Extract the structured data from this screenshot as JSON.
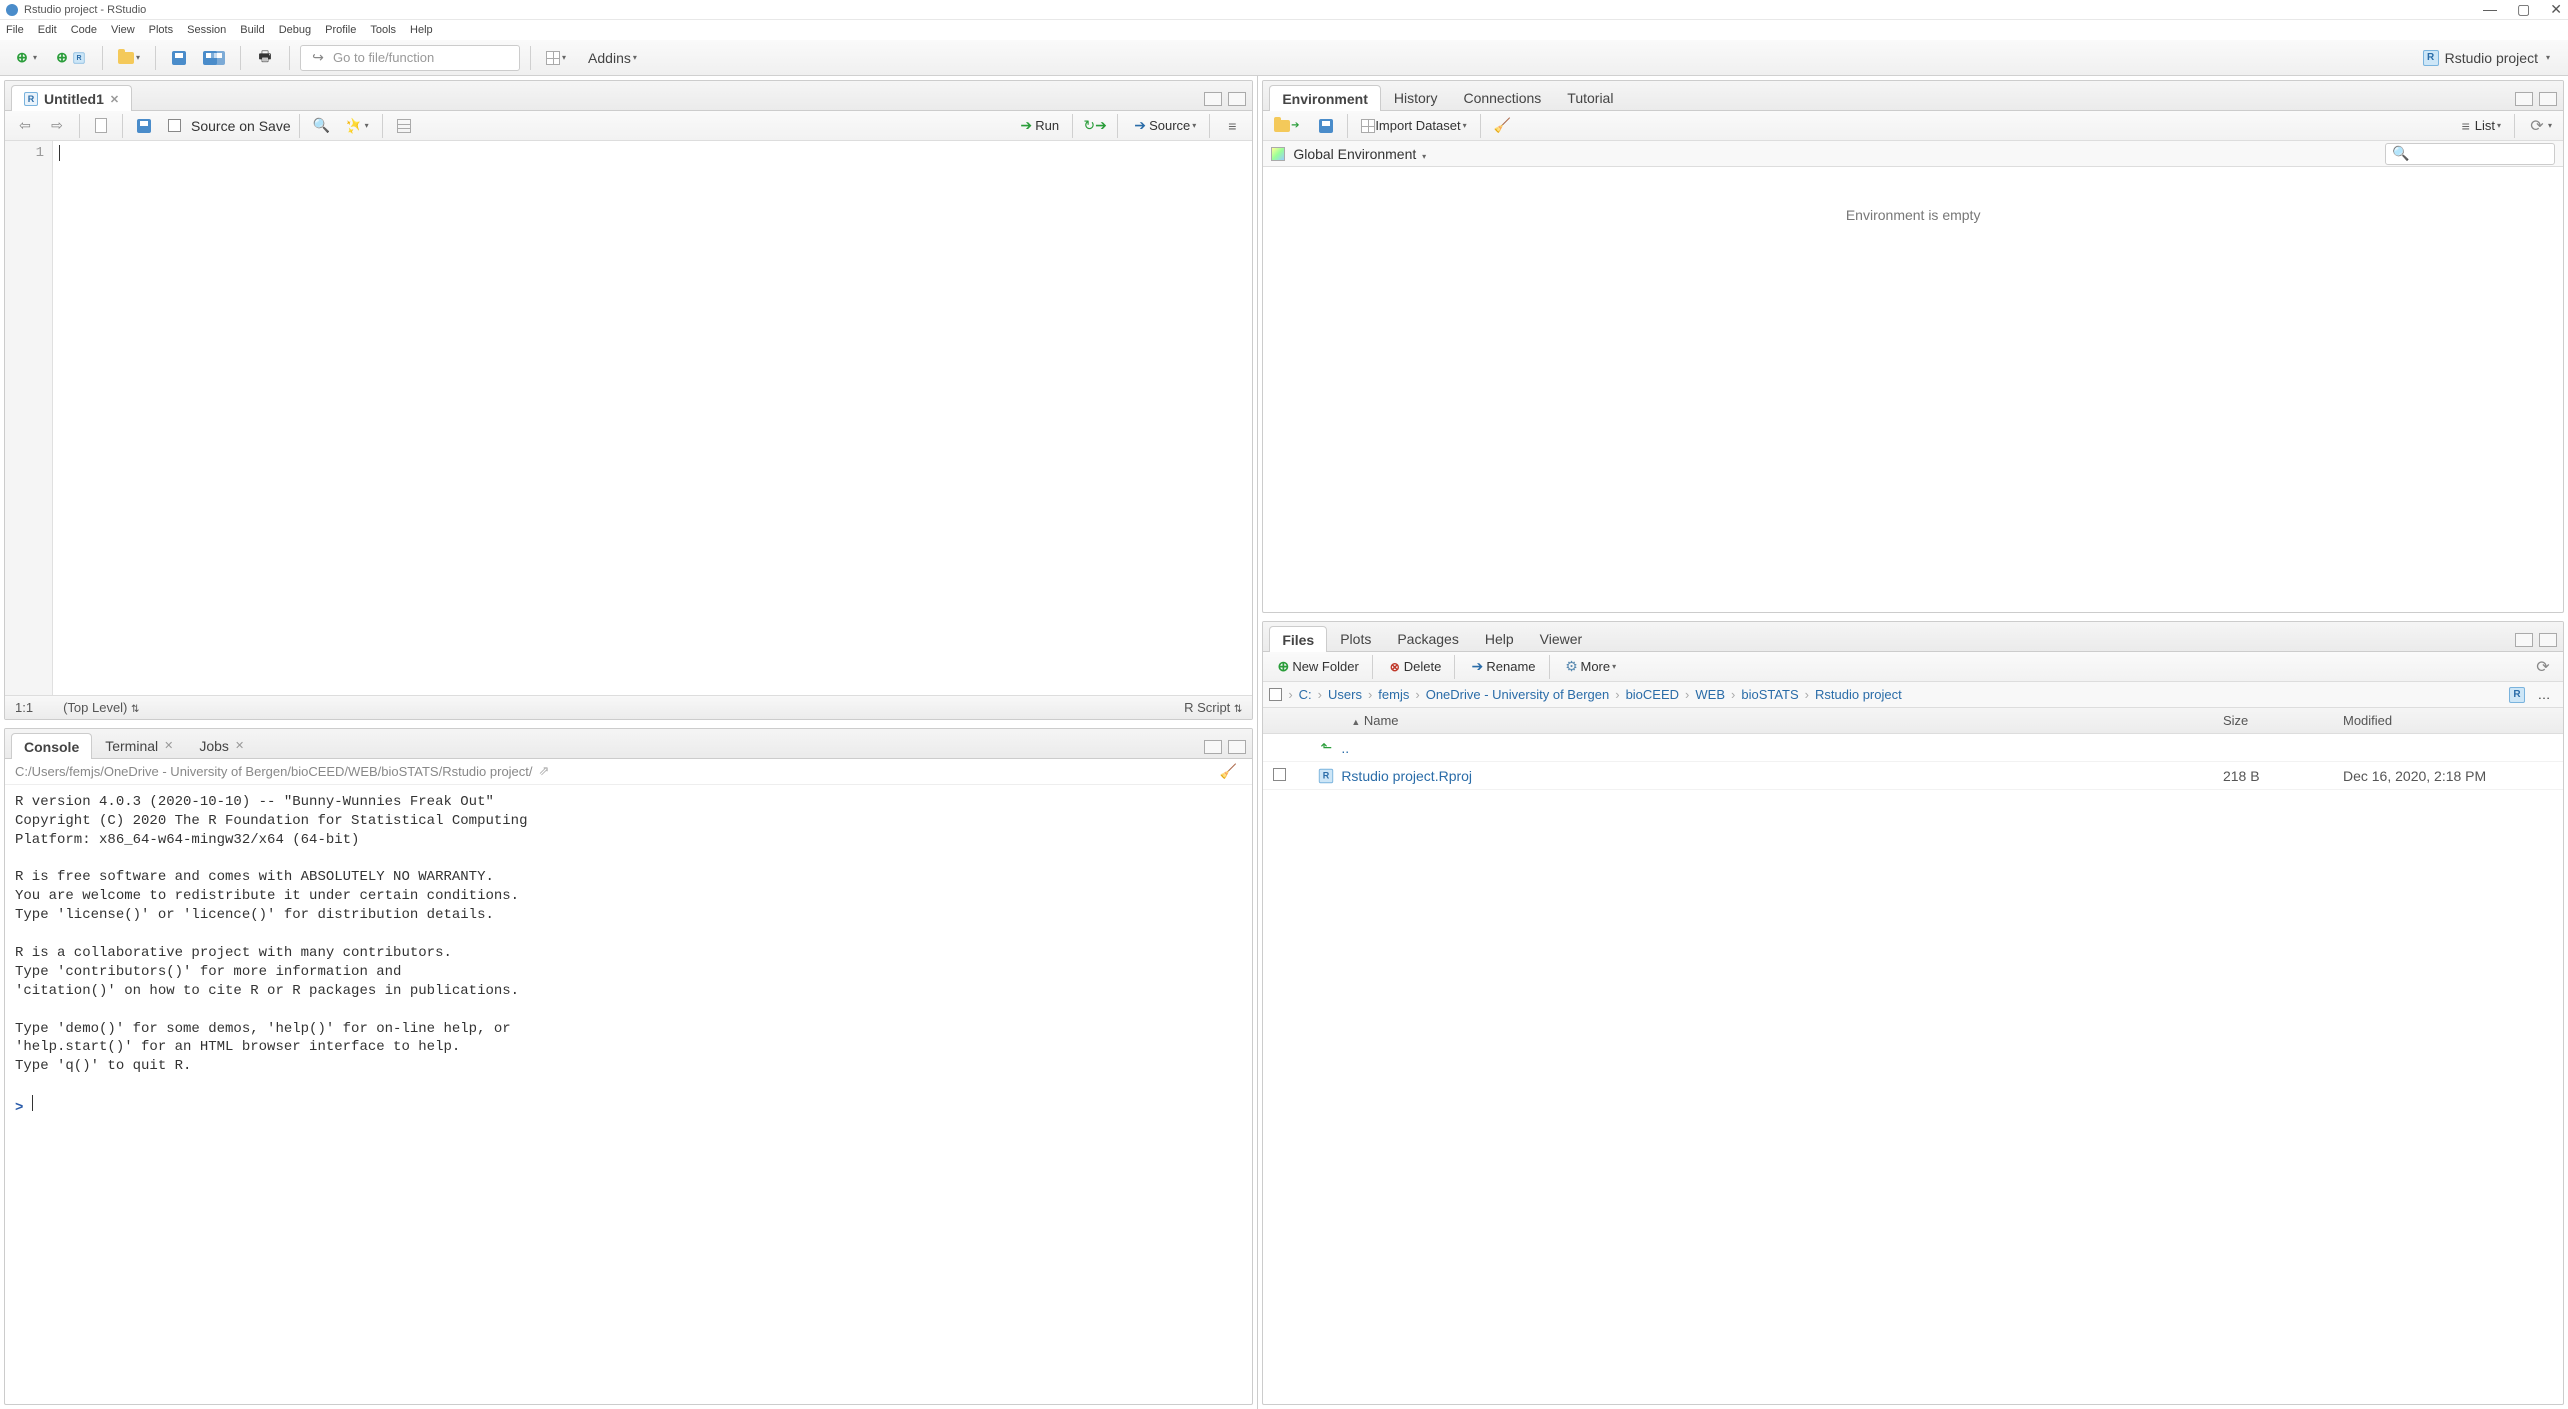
{
  "window": {
    "title": "Rstudio project - RStudio",
    "controls": {
      "min": "—",
      "max": "▢",
      "close": "✕"
    }
  },
  "menubar": [
    "File",
    "Edit",
    "Code",
    "View",
    "Plots",
    "Session",
    "Build",
    "Debug",
    "Profile",
    "Tools",
    "Help"
  ],
  "main_toolbar": {
    "goto_placeholder": "Go to file/function",
    "addins": "Addins",
    "project": "Rstudio project"
  },
  "source_pane": {
    "tab": "Untitled1",
    "source_on_save": "Source on Save",
    "run": "Run",
    "source": "Source",
    "gutter_line": "1",
    "status_pos": "1:1",
    "status_scope": "(Top Level)",
    "status_type": "R Script"
  },
  "console_pane": {
    "tabs": {
      "console": "Console",
      "terminal": "Terminal",
      "jobs": "Jobs"
    },
    "path": "C:/Users/femjs/OneDrive - University of Bergen/bioCEED/WEB/bioSTATS/Rstudio project/",
    "text": "R version 4.0.3 (2020-10-10) -- \"Bunny-Wunnies Freak Out\"\nCopyright (C) 2020 The R Foundation for Statistical Computing\nPlatform: x86_64-w64-mingw32/x64 (64-bit)\n\nR is free software and comes with ABSOLUTELY NO WARRANTY.\nYou are welcome to redistribute it under certain conditions.\nType 'license()' or 'licence()' for distribution details.\n\nR is a collaborative project with many contributors.\nType 'contributors()' for more information and\n'citation()' on how to cite R or R packages in publications.\n\nType 'demo()' for some demos, 'help()' for on-line help, or\n'help.start()' for an HTML browser interface to help.\nType 'q()' to quit R.\n",
    "prompt": ">"
  },
  "env_pane": {
    "tabs": {
      "environment": "Environment",
      "history": "History",
      "connections": "Connections",
      "tutorial": "Tutorial"
    },
    "import": "Import Dataset",
    "list": "List",
    "scope": "Global Environment",
    "empty": "Environment is empty"
  },
  "files_pane": {
    "tabs": {
      "files": "Files",
      "plots": "Plots",
      "packages": "Packages",
      "help": "Help",
      "viewer": "Viewer"
    },
    "toolbar": {
      "new_folder": "New Folder",
      "delete": "Delete",
      "rename": "Rename",
      "more": "More"
    },
    "breadcrumb": [
      "C:",
      "Users",
      "femjs",
      "OneDrive - University of Bergen",
      "bioCEED",
      "WEB",
      "bioSTATS",
      "Rstudio project"
    ],
    "headers": {
      "name": "Name",
      "size": "Size",
      "modified": "Modified"
    },
    "up": "..",
    "rows": [
      {
        "name": "Rstudio project.Rproj",
        "size": "218 B",
        "modified": "Dec 16, 2020, 2:18 PM"
      }
    ]
  }
}
